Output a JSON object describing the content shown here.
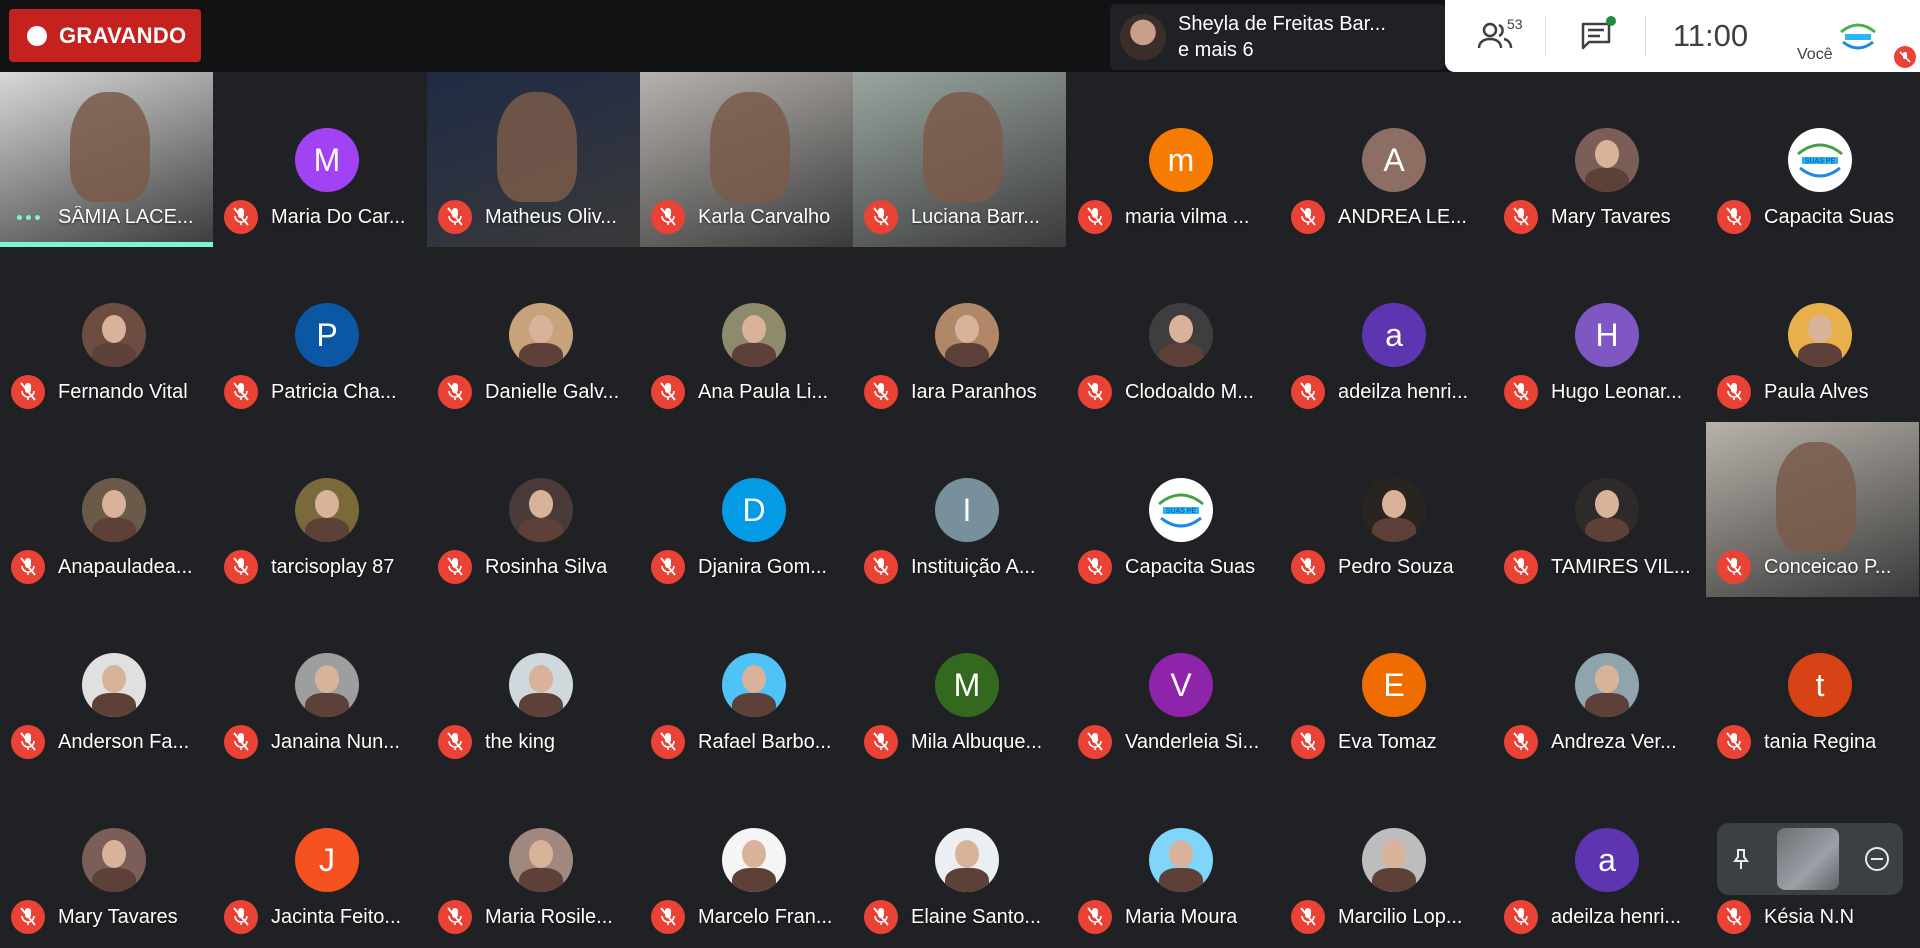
{
  "recording": {
    "label": "GRAVANDO",
    "color": "#c5221f"
  },
  "presenter": {
    "name": "Sheyla de Freitas Bar...",
    "more": "e mais 6"
  },
  "meeting_info": {
    "participant_count": "53",
    "time": "11:00",
    "self_label": "Você"
  },
  "colors": {
    "mic_off": "#ea4335",
    "speaking": "#7ff3d9",
    "background": "#202124"
  },
  "participants": [
    {
      "name": "SÂMIA LACE...",
      "kind": "video",
      "speaking": true,
      "bg": "#d8d8d8"
    },
    {
      "name": "Maria Do Car...",
      "kind": "letter",
      "letter": "M",
      "color": "#a142f4"
    },
    {
      "name": "Matheus Oliv...",
      "kind": "video",
      "bg": "#1f2a44"
    },
    {
      "name": "Karla Carvalho",
      "kind": "video",
      "bg": "#b6b2ad"
    },
    {
      "name": "Luciana Barr...",
      "kind": "video",
      "bg": "#9aa6a0"
    },
    {
      "name": "maria vilma ...",
      "kind": "letter",
      "letter": "m",
      "color": "#f57c00"
    },
    {
      "name": "ANDREA LE...",
      "kind": "letter",
      "letter": "A",
      "color": "#8d6e63"
    },
    {
      "name": "Mary Tavares",
      "kind": "photo",
      "color": "#7b5e57"
    },
    {
      "name": "Capacita Suas",
      "kind": "logo"
    },
    {
      "name": "Fernando Vital",
      "kind": "photo",
      "color": "#6d4c41"
    },
    {
      "name": "Patricia Cha...",
      "kind": "letter",
      "letter": "P",
      "color": "#0b57a4"
    },
    {
      "name": "Danielle Galv...",
      "kind": "photo",
      "color": "#c8a27a"
    },
    {
      "name": "Ana Paula Li...",
      "kind": "photo",
      "color": "#8d8b6b"
    },
    {
      "name": "Iara Paranhos",
      "kind": "photo",
      "color": "#b08868"
    },
    {
      "name": "Clodoaldo M...",
      "kind": "photo",
      "color": "#3e3e3e"
    },
    {
      "name": "adeilza henri...",
      "kind": "letter",
      "letter": "a",
      "color": "#5e35b1"
    },
    {
      "name": "Hugo Leonar...",
      "kind": "letter",
      "letter": "H",
      "color": "#7e57c2"
    },
    {
      "name": "Paula Alves",
      "kind": "photo",
      "color": "#e8b04a"
    },
    {
      "name": "Anapauladea...",
      "kind": "photo",
      "color": "#6b5a4a"
    },
    {
      "name": "tarcisoplay 87",
      "kind": "photo",
      "color": "#7a6a3a"
    },
    {
      "name": "Rosinha Silva",
      "kind": "photo",
      "color": "#4a3a3a"
    },
    {
      "name": "Djanira Gom...",
      "kind": "letter",
      "letter": "D",
      "color": "#039be5"
    },
    {
      "name": "Instituição A...",
      "kind": "letter",
      "letter": "I",
      "color": "#78909c"
    },
    {
      "name": "Capacita Suas",
      "kind": "logo"
    },
    {
      "name": "Pedro Souza",
      "kind": "photo",
      "color": "#2a2420"
    },
    {
      "name": "TAMIRES VIL...",
      "kind": "photo",
      "color": "#2e2a2a"
    },
    {
      "name": "Conceicao P...",
      "kind": "video",
      "bg": "#b8b2aa"
    },
    {
      "name": "Anderson Fa...",
      "kind": "photo",
      "color": "#e0e0e0"
    },
    {
      "name": "Janaina Nun...",
      "kind": "photo",
      "color": "#9e9e9e"
    },
    {
      "name": "the king",
      "kind": "photo",
      "color": "#cfd8dc"
    },
    {
      "name": "Rafael Barbo...",
      "kind": "photo",
      "color": "#4fc3f7"
    },
    {
      "name": "Mila Albuque...",
      "kind": "letter",
      "letter": "M",
      "color": "#33691e"
    },
    {
      "name": "Vanderleia Si...",
      "kind": "letter",
      "letter": "V",
      "color": "#8e24aa"
    },
    {
      "name": "Eva Tomaz",
      "kind": "letter",
      "letter": "E",
      "color": "#ef6c00"
    },
    {
      "name": "Andreza Ver...",
      "kind": "photo",
      "color": "#90a4ae"
    },
    {
      "name": "tania Regina",
      "kind": "letter",
      "letter": "t",
      "color": "#d84315"
    },
    {
      "name": "Mary Tavares",
      "kind": "photo",
      "color": "#7b5e57"
    },
    {
      "name": "Jacinta Feito...",
      "kind": "letter",
      "letter": "J",
      "color": "#f4511e"
    },
    {
      "name": "Maria Rosile...",
      "kind": "photo",
      "color": "#a1887f"
    },
    {
      "name": "Marcelo Fran...",
      "kind": "photo",
      "color": "#f5f5f5"
    },
    {
      "name": "Elaine Santo...",
      "kind": "photo",
      "color": "#eceff1"
    },
    {
      "name": "Maria Moura",
      "kind": "photo",
      "color": "#81d4fa"
    },
    {
      "name": "Marcilio Lop...",
      "kind": "photo",
      "color": "#bdbdbd"
    },
    {
      "name": "adeilza henri...",
      "kind": "letter",
      "letter": "a",
      "color": "#5e35b1"
    },
    {
      "name": "Késia N.N",
      "kind": "none"
    }
  ]
}
